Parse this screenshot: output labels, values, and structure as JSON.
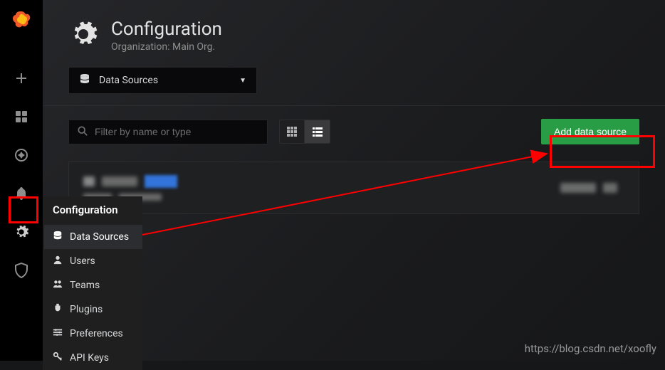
{
  "header": {
    "title": "Configuration",
    "subtitle": "Organization: Main Org."
  },
  "dropdown": {
    "label": "Data Sources"
  },
  "search": {
    "placeholder": "Filter by name or type"
  },
  "actions": {
    "add": "Add data source"
  },
  "flyout": {
    "title": "Configuration",
    "items": [
      {
        "label": "Data Sources"
      },
      {
        "label": "Users"
      },
      {
        "label": "Teams"
      },
      {
        "label": "Plugins"
      },
      {
        "label": "Preferences"
      },
      {
        "label": "API Keys"
      }
    ]
  },
  "watermark": "https://blog.csdn.net/xoofly"
}
